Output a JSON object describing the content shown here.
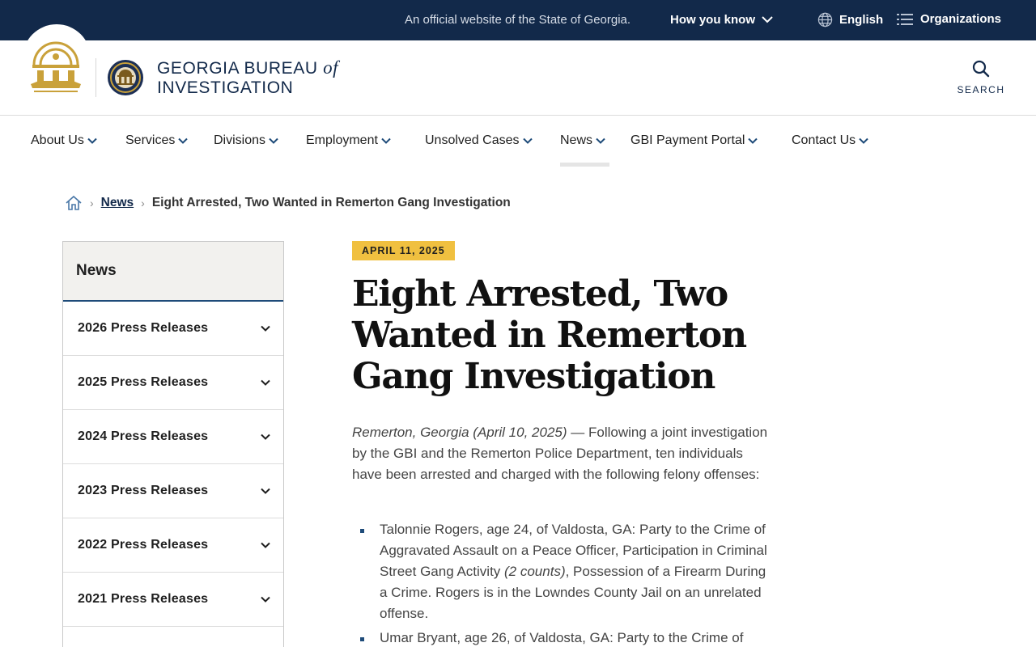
{
  "topbar": {
    "official_text": "An official website of the State of Georgia.",
    "how_you_know": "How you know",
    "language": "English",
    "organizations": "Organizations"
  },
  "header": {
    "brand_line1": "GEORGIA BUREAU",
    "brand_of": "of",
    "brand_line2": "INVESTIGATION",
    "search_label": "SEARCH"
  },
  "nav": {
    "items": [
      {
        "label": "About Us"
      },
      {
        "label": "Services"
      },
      {
        "label": "Divisions"
      },
      {
        "label": "Employment"
      },
      {
        "label": "Unsolved Cases"
      },
      {
        "label": "News"
      },
      {
        "label": "GBI Payment Portal"
      },
      {
        "label": "Contact Us"
      }
    ],
    "active": "News"
  },
  "breadcrumb": {
    "parent": "News",
    "current": "Eight Arrested, Two Wanted in Remerton Gang Investigation"
  },
  "sidebar": {
    "title": "News",
    "items": [
      {
        "label": "2026 Press Releases"
      },
      {
        "label": "2025 Press Releases"
      },
      {
        "label": "2024 Press Releases"
      },
      {
        "label": "2023 Press Releases"
      },
      {
        "label": "2022 Press Releases"
      },
      {
        "label": "2021 Press Releases"
      }
    ]
  },
  "article": {
    "date": "APRIL 11, 2025",
    "headline": "Eight Arrested, Two Wanted in Remerton Gang Investigation",
    "dateline": "Remerton, Georgia (April 10, 2025)",
    "lead": " — Following a joint investigation by the GBI and the Remerton Police Department, ten individuals have been arrested and charged with the following felony offenses:",
    "bullet1_a": "Talonnie Rogers, age 24, of Valdosta, GA: Party to the Crime of Aggravated Assault on a Peace Officer, Participation in Criminal Street Gang Activity ",
    "bullet1_counts": "(2 counts)",
    "bullet1_b": ", Possession of a Firearm During a Crime. Rogers is in the Lowndes County Jail on an unrelated offense.",
    "bullet2": "Umar Bryant, age 26, of Valdosta, GA: Party to the Crime of"
  },
  "colors": {
    "navy": "#12294a",
    "accent_blue": "#1e4b79",
    "badge_gold": "#f0c040"
  }
}
